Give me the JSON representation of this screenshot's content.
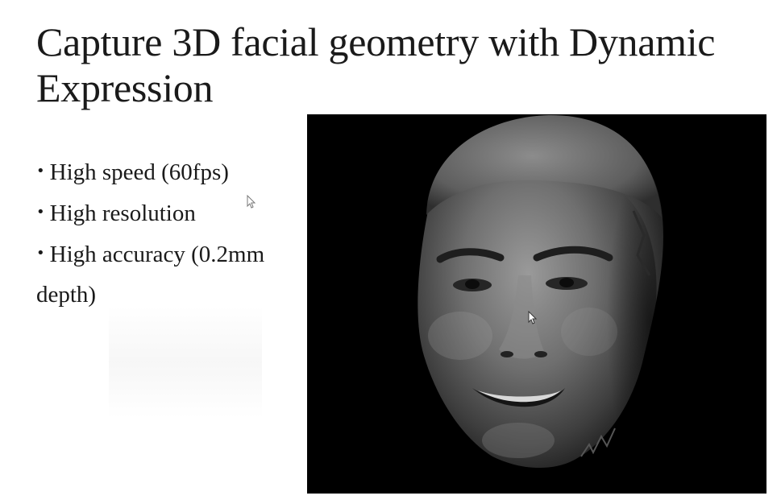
{
  "slide": {
    "title": "Capture 3D facial geometry with Dynamic Expression",
    "bullets": [
      {
        "text": "High speed (60fps)"
      },
      {
        "text": "High resolution"
      },
      {
        "text": "High accuracy (0.2mm depth)"
      }
    ]
  },
  "figure": {
    "image": "3D facial scan render of a smiling face on black background",
    "background": "#000000"
  },
  "colors": {
    "text": "#1a1a1a",
    "background": "#ffffff"
  },
  "icons": {
    "bullet": "bullet-dot-icon",
    "cursor": "mouse-pointer-icon"
  }
}
